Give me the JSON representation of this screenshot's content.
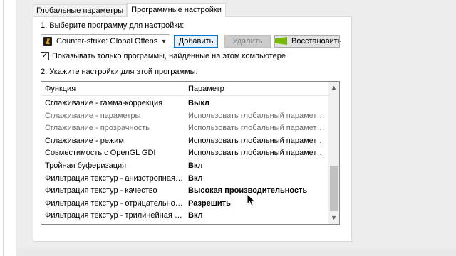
{
  "tabs": [
    {
      "label": "Глобальные параметры",
      "active": false
    },
    {
      "label": "Программные настройки",
      "active": true
    }
  ],
  "step1": {
    "label": "1. Выберите программу для настройки:",
    "program": "Counter-strike: Global Offensiv...",
    "program_icon": "csgo-game-icon",
    "add_label": "Добавить",
    "remove_label": "Удалить",
    "restore_label": "Восстановить"
  },
  "filter": {
    "checked": true,
    "label": "Показывать только программы, найденные на этом компьютере"
  },
  "step2": {
    "label": "2. Укажите настройки для этой программы:",
    "columns": [
      "Функция",
      "Параметр"
    ],
    "rows": [
      {
        "feature": "Сглаживание - гамма-коррекция",
        "value": "Выкл",
        "bold": true,
        "dim": false
      },
      {
        "feature": "Сглаживание - параметры",
        "value": "Использовать глобальный параметр (Нет)",
        "bold": false,
        "dim": true
      },
      {
        "feature": "Сглаживание - прозрачность",
        "value": "Использовать глобальный параметр (В...",
        "bold": false,
        "dim": true
      },
      {
        "feature": "Сглаживание - режим",
        "value": "Использовать глобальный параметр (В...",
        "bold": false,
        "dim": false
      },
      {
        "feature": "Совместимость с OpenGL GDI",
        "value": "Использовать глобальный параметр (А...",
        "bold": false,
        "dim": false
      },
      {
        "feature": "Тройная буферизация",
        "value": "Вкл",
        "bold": true,
        "dim": false
      },
      {
        "feature": "Фильтрация текстур - анизотропная оп...",
        "value": "Вкл",
        "bold": true,
        "dim": false
      },
      {
        "feature": "Фильтрация текстур - качество",
        "value": "Высокая производительность",
        "bold": true,
        "dim": false
      },
      {
        "feature": "Фильтрация текстур - отрицательное о...",
        "value": "Разрешить",
        "bold": true,
        "dim": false
      },
      {
        "feature": "Фильтрация текстур - трилинейная опт...",
        "value": "Вкл",
        "bold": true,
        "dim": false
      }
    ]
  },
  "colors": {
    "accent": "#0078d7",
    "nvidia": "#76b900"
  }
}
